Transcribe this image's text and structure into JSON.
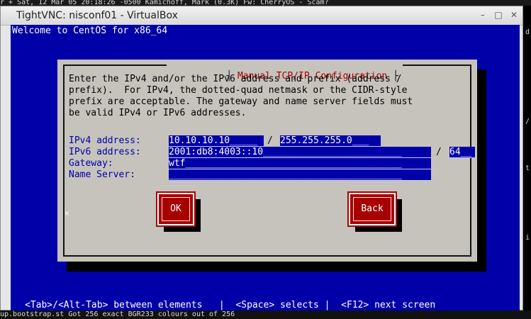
{
  "background": {
    "top_text": "r + Sat, 12 Mar 05 20:18:26 -0500 Kamichoff, Mark       (0.3K) Fw: CherryOS - Scam?",
    "bottom_text": "up.bootstrap.st       Got 256 exact BGR233 colours out of 256",
    "side_left": [
      "r",
      "r",
      "8",
      "9",
      "10",
      "11",
      "12",
      "13",
      "14",
      "15",
      "16",
      "17",
      "18",
      "19",
      "20",
      "21",
      "22",
      "23",
      "24",
      "25",
      "H",
      "",
      "",
      "",
      "r",
      "er",
      "20",
      "20",
      "er",
      "er"
    ],
    "side_right": [
      "d",
      "/",
      "t",
      "i"
    ]
  },
  "window": {
    "title": "TightVNC: nisconf01 - VirtualBox",
    "minimize": "–",
    "maximize": "□",
    "close": "✕"
  },
  "screen": {
    "welcome": "Welcome to CentOS for x86_64",
    "dialog": {
      "title": "Manual TCP/IP Configuration",
      "intro": "Enter the IPv4 and/or the IPv6 address and prefix (address /\nprefix).  For IPv4, the dotted-quad netmask or the CIDR-style\nprefix are acceptable. The gateway and name server fields must\nbe valid IPv4 or IPv6 addresses.",
      "fields": {
        "ipv4_label": "IPv4 address:",
        "ipv4_value": "10.10.10.10_____",
        "ipv4_sep": "/",
        "ipv4_mask": "255.255.255.0___",
        "ipv6_label": "IPv6 address:",
        "ipv6_value": "2001:db8:4003::10_________________________",
        "ipv6_sep": "/",
        "ipv6_prefix": "64__",
        "gateway_label": "Gateway:",
        "gateway_value": "wtf_______________________________________",
        "ns_label": "Name Server:",
        "ns_value": "__________________________________________"
      },
      "buttons": {
        "ok": "OK",
        "back": "Back"
      }
    },
    "help": "<Tab>/<Alt-Tab> between elements   |  <Space> selects |  <F12> next screen"
  },
  "colors": {
    "screen_blue": "#0000a8",
    "dialog_gray": "#c6c3bd",
    "accent_red": "#a80000"
  }
}
